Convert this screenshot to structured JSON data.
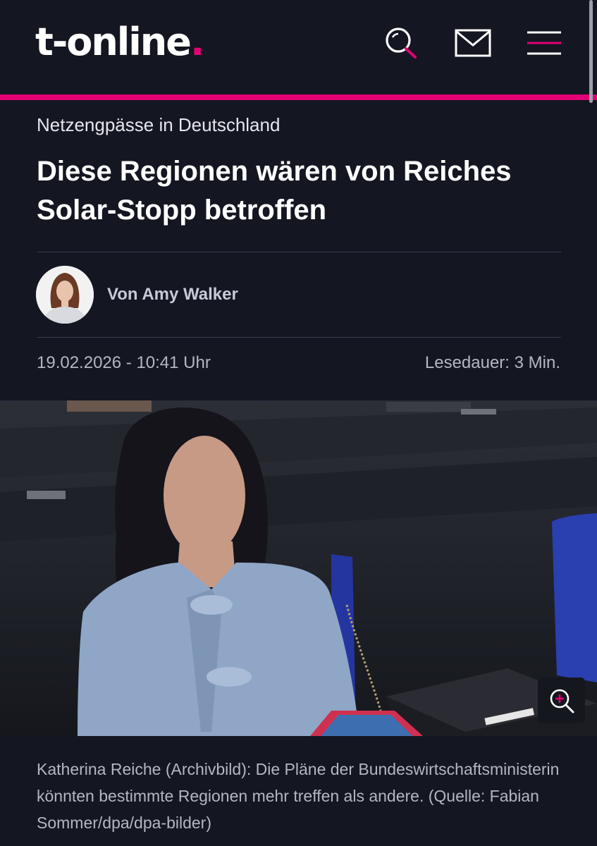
{
  "header": {
    "logo_text": "t-online",
    "logo_dot": ".",
    "accent_color": "#e20074",
    "icons": [
      "search-icon",
      "mail-icon",
      "menu-icon"
    ]
  },
  "article": {
    "kicker": "Netzengpässe in Deutschland",
    "headline": "Diese Regionen wären von Reiches Solar-Stopp betroffen",
    "author": "Von Amy Walker",
    "date": "19.02.2026 - 10:41 Uhr",
    "reading_time": "Lesedauer: 3 Min.",
    "image": {
      "caption": "Katherina Reiche (Archivbild): Die Pläne der Bundeswirtschaftsministerin könnten bestimmte Regionen mehr treffen als andere. (Quelle: Fabian Sommer/dpa/dpa-bilder)",
      "zoom_icon": "zoom-in-icon"
    }
  }
}
